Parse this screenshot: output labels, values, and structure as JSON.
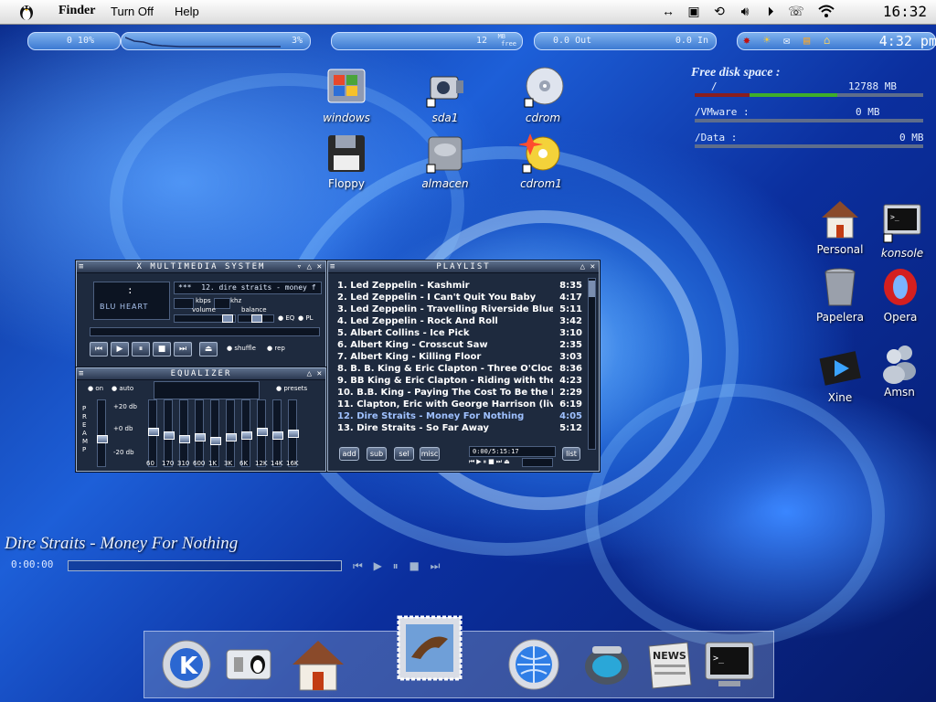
{
  "menubar": {
    "app": "Finder",
    "items": [
      "Turn Off",
      "Help"
    ],
    "clock": "16:32"
  },
  "monitors": {
    "cpu_left": "0 10%",
    "cpu": "3%",
    "mem": "12",
    "mem_unit": "MB",
    "mem_sub": "free",
    "net_out": "0.0 Out",
    "net_in": "0.0 In",
    "time": "4:32 pm"
  },
  "desktop_icons": [
    {
      "name": "windows",
      "label": "windows"
    },
    {
      "name": "sda1",
      "label": "sda1"
    },
    {
      "name": "cdrom",
      "label": "cdrom"
    },
    {
      "name": "floppy",
      "label": "Floppy"
    },
    {
      "name": "almacen",
      "label": "almacen"
    },
    {
      "name": "cdrom1",
      "label": "cdrom1"
    },
    {
      "name": "personal",
      "label": "Personal"
    },
    {
      "name": "konsole",
      "label": "konsole"
    },
    {
      "name": "papelera",
      "label": "Papelera"
    },
    {
      "name": "opera",
      "label": "Opera"
    },
    {
      "name": "xine",
      "label": "Xine"
    },
    {
      "name": "amsn",
      "label": "Amsn"
    }
  ],
  "disk": {
    "title": "Free disk space :",
    "rows": [
      {
        "label": "/",
        "value": "12788 MB",
        "level": 0.61
      },
      {
        "label": "/VMware :",
        "value": "0 MB",
        "level": 0
      },
      {
        "label": "/Data :",
        "value": "0 MB",
        "level": 0
      }
    ]
  },
  "player": {
    "title": "X MULTIMEDIA SYSTEM",
    "ticker": "12. dire straits - money f",
    "ticker_prefix": "***",
    "time_display": ":",
    "skin": "BLU HEART",
    "kbps_label": "kbps",
    "khz_label": "khz",
    "volume_label": "volume",
    "balance_label": "balance",
    "eq_label": "EQ",
    "pl_label": "PL",
    "shuffle_label": "shuffle",
    "repeat_label": "rep"
  },
  "equalizer": {
    "title": "EQUALIZER",
    "on_label": "on",
    "auto_label": "auto",
    "presets_label": "presets",
    "preamp_label": "PREAMP",
    "db_plus": "+20 db",
    "db_zero": "+0 db",
    "db_minus": "-20 db",
    "bands": [
      "60",
      "170",
      "310",
      "600",
      "1K",
      "3K",
      "6K",
      "12K",
      "14K",
      "16K"
    ]
  },
  "playlist": {
    "title": "PLAYLIST",
    "tracks": [
      {
        "title": "1. Led Zeppelin - Kashmir",
        "duration": "8:35"
      },
      {
        "title": "2. Led Zeppelin - I Can't Quit You Baby",
        "duration": "4:17"
      },
      {
        "title": "3. Led Zeppelin - Travelling Riverside Blues",
        "duration": "5:11"
      },
      {
        "title": "4. Led Zeppelin - Rock And Roll",
        "duration": "3:42"
      },
      {
        "title": "5. Albert Collins - Ice Pick",
        "duration": "3:10"
      },
      {
        "title": "6. Albert King - Crosscut Saw",
        "duration": "2:35"
      },
      {
        "title": "7. Albert King - Killing Floor",
        "duration": "3:03"
      },
      {
        "title": "8. B. B. King & Eric Clapton - Three O'Clock B...",
        "duration": "8:36"
      },
      {
        "title": "9. BB King & Eric Clapton - Riding with the King",
        "duration": "4:23"
      },
      {
        "title": "10. B.B. King - Paying The Cost To Be the Boss",
        "duration": "2:29"
      },
      {
        "title": "11. Clapton, Eric with George Harrison (live) - ...",
        "duration": "6:19"
      },
      {
        "title": "12. Dire Straits - Money For Nothing",
        "duration": "4:05"
      },
      {
        "title": "13. Dire Straits - So Far Away",
        "duration": "5:12"
      }
    ],
    "current_index": 11,
    "buttons": [
      "add",
      "sub",
      "sel",
      "misc"
    ],
    "list_button": "list",
    "time_readout": "0:00/5:15:17"
  },
  "now_playing": {
    "title": "Dire Straits - Money For Nothing",
    "time": "0:00:00"
  },
  "dock": [
    "kde-menu",
    "tux-switch",
    "home",
    "mail",
    "konqueror",
    "music-player",
    "news",
    "terminal"
  ],
  "colors": {
    "accent": "#1d5fd8",
    "disk_free": "#3fae2a",
    "disk_used": "#8a1e1e"
  }
}
